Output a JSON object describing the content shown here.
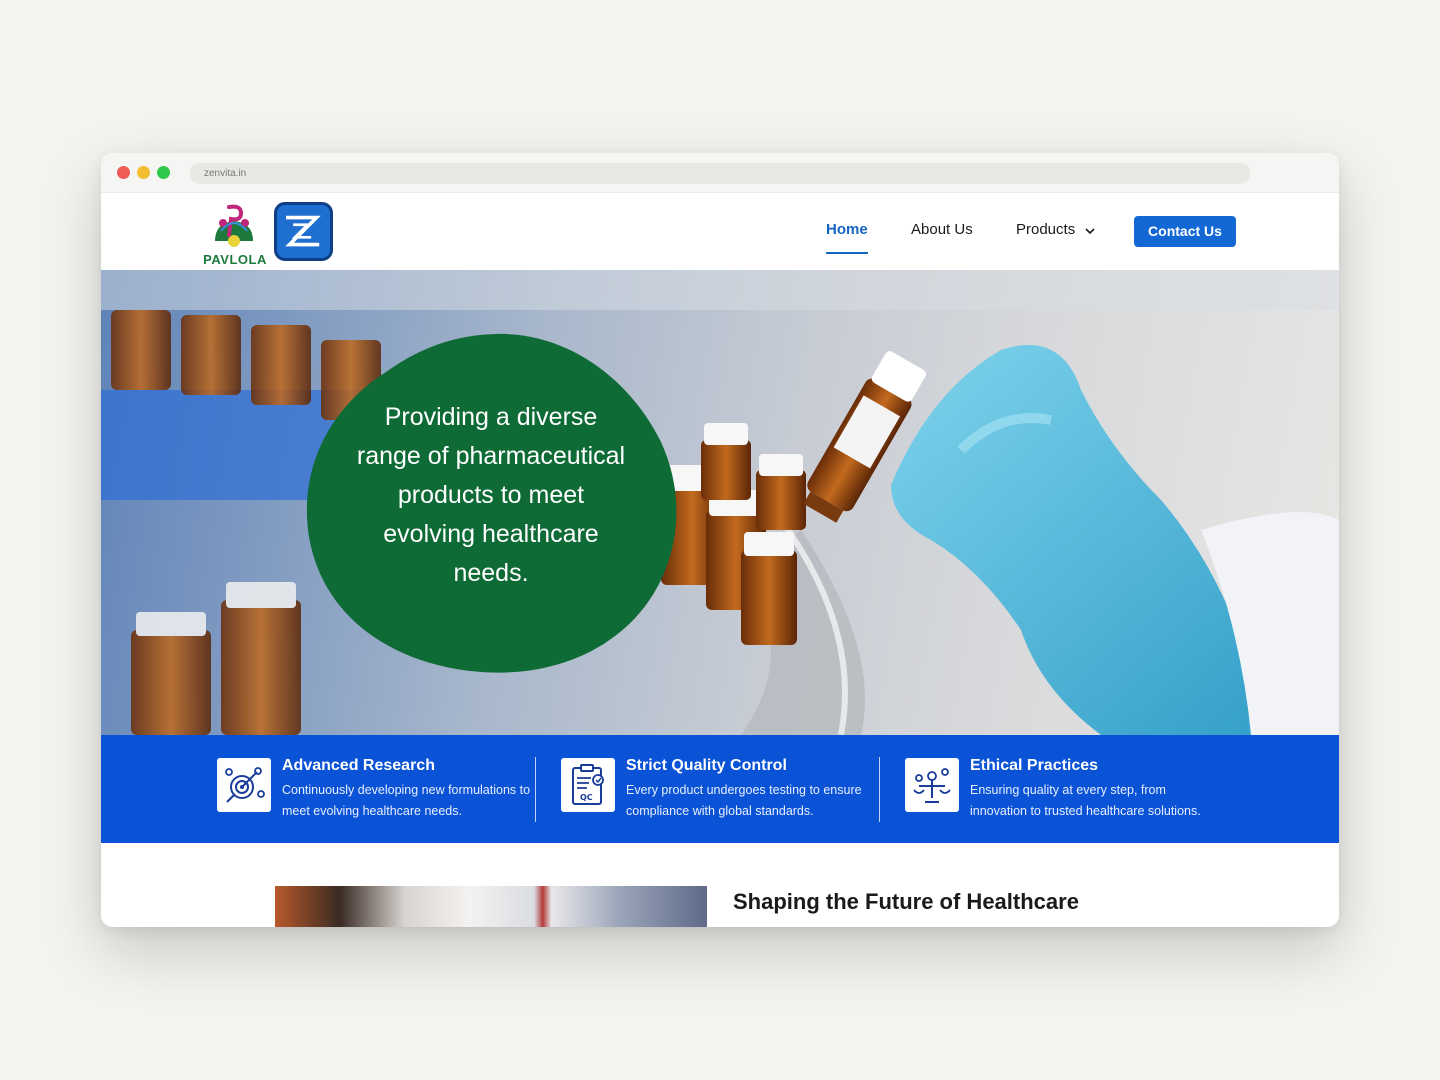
{
  "browser": {
    "url": "zenvita.in"
  },
  "brand": {
    "name": "PAVLOLA",
    "accent": "#1565c0",
    "green": "#0e6b36",
    "blue_band": "#0a52d6"
  },
  "nav": {
    "links": [
      {
        "label": "Home"
      },
      {
        "label": "About Us"
      },
      {
        "label": "Products"
      }
    ],
    "cta": "Contact Us"
  },
  "hero": {
    "headline": "Providing a diverse range of pharmaceutical products to meet evolving healthcare needs."
  },
  "features": [
    {
      "title": "Advanced Research",
      "desc": "Continuously developing new formulations to meet evolving healthcare needs.",
      "icon": "research-target-icon"
    },
    {
      "title": "Strict Quality Control",
      "desc": "Every product undergoes testing to ensure compliance with global standards.",
      "icon": "qc-clipboard-icon"
    },
    {
      "title": "Ethical Practices",
      "desc": "Ensuring quality at every step, from innovation to trusted healthcare solutions.",
      "icon": "ethics-balance-icon"
    }
  ],
  "section": {
    "title": "Shaping the Future of Healthcare"
  }
}
